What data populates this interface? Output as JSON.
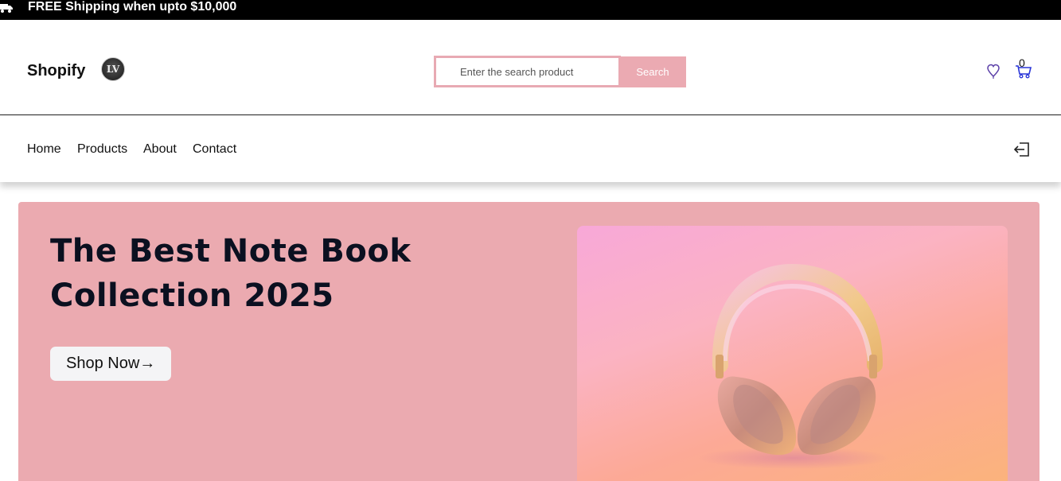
{
  "topbar": {
    "promo": "FREE Shipping when upto $10,000",
    "icon": "truck-icon"
  },
  "header": {
    "brand": "Shopify",
    "logo_text": "LV",
    "search": {
      "placeholder": "Enter the search product",
      "value": "",
      "button_label": "Search"
    },
    "wishlist_icon": "heart-icon",
    "cart_icon": "cart-icon",
    "cart_count": "0"
  },
  "nav": {
    "items": [
      {
        "label": "Home"
      },
      {
        "label": "Products"
      },
      {
        "label": "About"
      },
      {
        "label": "Contact"
      }
    ],
    "login_icon": "login-icon"
  },
  "hero": {
    "title_line1": "The Best Note Book",
    "title_line2": "Collection 2025",
    "cta_label": "Shop Now→",
    "image": "headphones-image"
  },
  "colors": {
    "accent_pink": "#ebaab2",
    "topbar_bg": "#000000",
    "heading": "#0b1020",
    "icon_purple": "#5b3fa8",
    "icon_blue": "#2a36d8"
  }
}
